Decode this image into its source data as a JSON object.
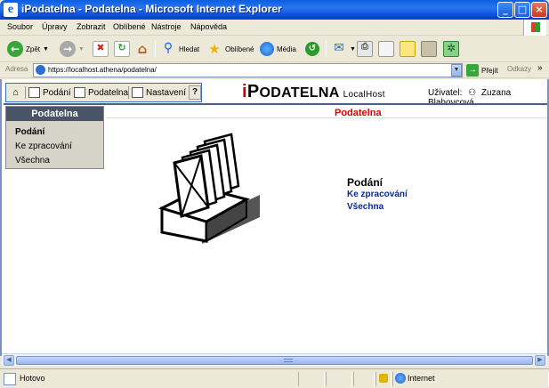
{
  "window": {
    "title": "iPodatelna - Podatelna - Microsoft Internet Explorer",
    "controls": [
      "_",
      "□",
      "×"
    ]
  },
  "menu": [
    "Soubor",
    "Úpravy",
    "Zobrazit",
    "Oblíbené",
    "Nástroje",
    "Nápověda"
  ],
  "toolbar": {
    "back": "Zpět",
    "search": "Hledat",
    "favorites": "Oblíbené",
    "media": "Média"
  },
  "address": {
    "label": "Adresa",
    "url": "https://localhost.athena/podatelna/",
    "go": "Přejít",
    "links": "Odkazy",
    "more": "»"
  },
  "app_toolbar": {
    "items": [
      "Podání",
      "Podatelna",
      "Nastavení"
    ],
    "help": "?"
  },
  "brand": {
    "i": "i",
    "p": "P",
    "odatelna": "ODATELNA",
    "host": "LocalHost"
  },
  "user": {
    "label": "Uživatel:",
    "name": "Zuzana Blahovcová"
  },
  "sidebar": {
    "title": "Podatelna",
    "items": [
      "Podání",
      "Ke zpracování",
      "Všechna"
    ]
  },
  "main": {
    "heading": "Podatelna",
    "menu_title": "Podání",
    "links": [
      "Ke zpracování",
      "Všechna"
    ]
  },
  "status": {
    "text": "Hotovo",
    "zone": "Internet"
  },
  "colors": {
    "heading_red": "#e00000",
    "link_blue": "#0b2a8a",
    "sidebar_header": "#4a5468"
  }
}
